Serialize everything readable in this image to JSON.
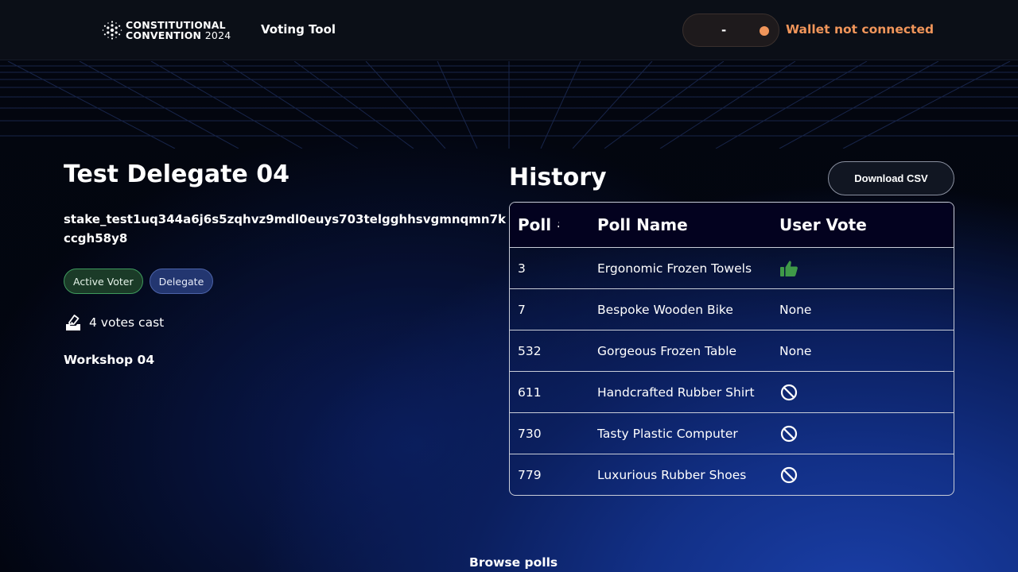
{
  "nav": {
    "logo_line1": "CONSTITUTIONAL",
    "logo_line2": "CONVENTION",
    "logo_year": "2024",
    "brand_link": "Voting Tool",
    "wallet_balance": "-",
    "wallet_status": "Wallet not connected",
    "wallet_status_color": "#f0955a"
  },
  "delegate": {
    "name": "Test Delegate 04",
    "stake_address": "stake_test1uq344a6j6s5zqhvz9mdl0euys703telgghhsvgmnqmn7kccgh58y8",
    "badges": [
      "Active Voter",
      "Delegate"
    ],
    "votes_cast": "4 votes cast",
    "workshop": "Workshop 04"
  },
  "history": {
    "title": "History",
    "download_label": "Download CSV",
    "columns": [
      "Poll #",
      "Poll Name",
      "User Vote"
    ],
    "rows": [
      {
        "poll": "3",
        "name": "Ergonomic Frozen Towels",
        "vote": "",
        "vote_icon": "thumbs-up-icon"
      },
      {
        "poll": "7",
        "name": "Bespoke Wooden Bike",
        "vote": "None",
        "vote_icon": ""
      },
      {
        "poll": "532",
        "name": "Gorgeous Frozen Table",
        "vote": "None",
        "vote_icon": ""
      },
      {
        "poll": "611",
        "name": "Handcrafted Rubber Shirt",
        "vote": "",
        "vote_icon": "abstain-icon"
      },
      {
        "poll": "730",
        "name": "Tasty Plastic Computer",
        "vote": "",
        "vote_icon": "abstain-icon"
      },
      {
        "poll": "779",
        "name": "Luxurious Rubber Shoes",
        "vote": "",
        "vote_icon": "abstain-icon"
      }
    ]
  },
  "footer": {
    "browse_link": "Browse polls"
  },
  "colors": {
    "thumbs_up": "#3f9a48",
    "accent_orange": "#f0955a"
  }
}
